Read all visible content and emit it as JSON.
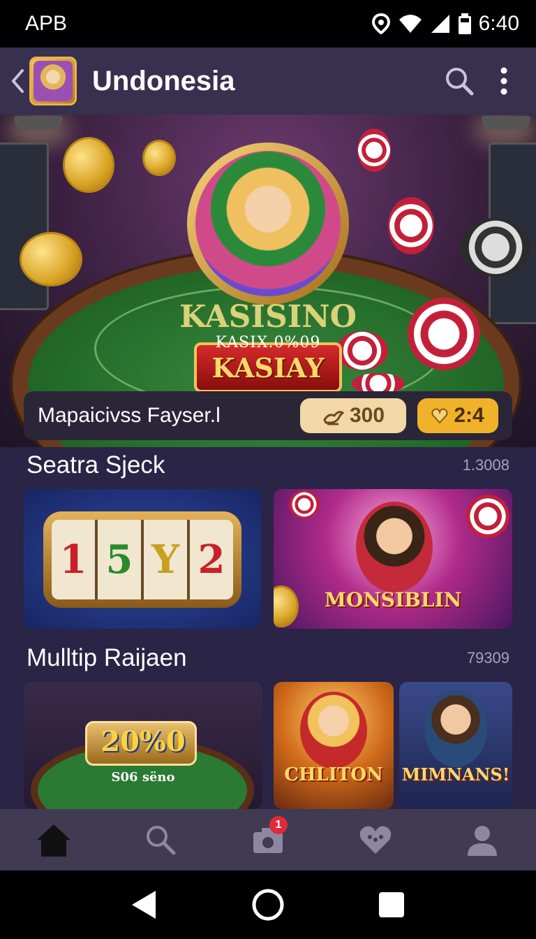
{
  "status_bar": {
    "carrier": "APB",
    "time": "6:40"
  },
  "app_bar": {
    "title": "Undonesia",
    "back_icon": "chevron-left-icon",
    "search_icon": "search-icon",
    "menu_icon": "more-vertical-icon"
  },
  "hero": {
    "banner_label": "KASIAY",
    "felt_title": "KASISINO",
    "felt_subtitle": "KASIX.0%09"
  },
  "promo": {
    "title": "Mapaicivss Fayser.l",
    "coins_value": "300",
    "hearts_value": "2:4"
  },
  "sections": [
    {
      "title": "Seatra Sjeck",
      "count": "1.3008",
      "tiles": [
        {
          "reels": [
            "1",
            "5",
            "Y",
            "2"
          ],
          "reel_colors": [
            "#c8202a",
            "#2a8a2a",
            "#c8a020",
            "#c8202a"
          ]
        },
        {
          "label": "MONSIBLIN"
        }
      ]
    },
    {
      "title": "Mulltip Raijaen",
      "count": "79309",
      "tiles": [
        {
          "label": "20%0",
          "sublabel": "S06 sëno"
        },
        {
          "label": "CHLITON"
        },
        {
          "label": "MIMNANS!"
        }
      ]
    }
  ],
  "bottom_nav": {
    "items": [
      "home-icon",
      "search-icon",
      "camera-icon",
      "heart-icon",
      "profile-icon"
    ],
    "badge": "1"
  },
  "colors": {
    "background": "#2a2446",
    "app_bar": "#37304f",
    "nav_bar": "#403a52",
    "accent_gold": "#f0b22a",
    "badge_red": "#e02a3a"
  }
}
